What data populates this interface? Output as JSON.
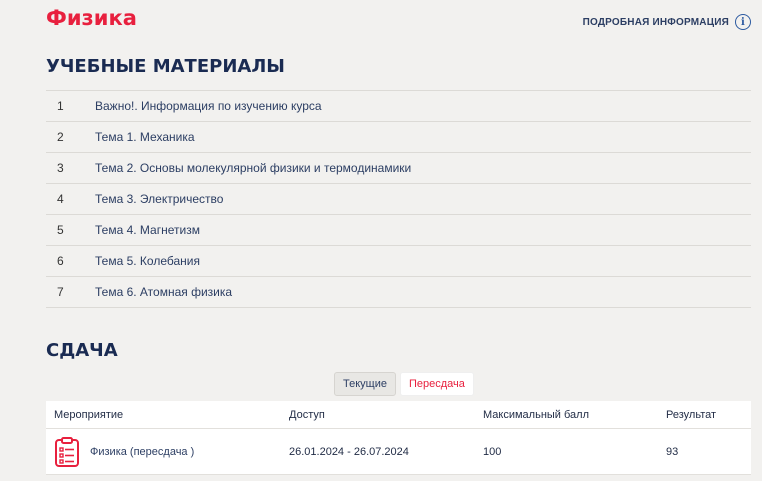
{
  "course": {
    "title": "Физика"
  },
  "header": {
    "info_link": "ПОДРОБНАЯ ИНФОРМАЦИЯ",
    "info_icon": "info-icon"
  },
  "materials": {
    "title": "УЧЕБНЫЕ МАТЕРИАЛЫ",
    "items": [
      {
        "num": "1",
        "label": "Важно!. Информация по изучению курса"
      },
      {
        "num": "2",
        "label": "Тема 1. Механика"
      },
      {
        "num": "3",
        "label": "Тема 2. Основы молекулярной физики и термодинамики"
      },
      {
        "num": "4",
        "label": "Тема 3. Электричество"
      },
      {
        "num": "5",
        "label": "Тема 4. Магнетизм"
      },
      {
        "num": "6",
        "label": "Тема 5. Колебания"
      },
      {
        "num": "7",
        "label": "Тема 6. Атомная физика"
      }
    ]
  },
  "exams": {
    "title": "СДАЧА",
    "tabs": {
      "current": "Текущие",
      "retake": "Пересдача",
      "active": "retake"
    },
    "columns": {
      "event": "Мероприятие",
      "access": "Доступ",
      "max_score": "Максимальный балл",
      "result": "Результат"
    },
    "rows": [
      {
        "icon": "clipboard-icon",
        "event": "Физика (пересдача )",
        "access": "26.01.2024 - 26.07.2024",
        "max_score": "100",
        "result": "93"
      }
    ]
  },
  "colors": {
    "accent": "#e8203e",
    "heading": "#1a2b52",
    "link": "#2c3e63",
    "background": "#f2f1ef"
  }
}
